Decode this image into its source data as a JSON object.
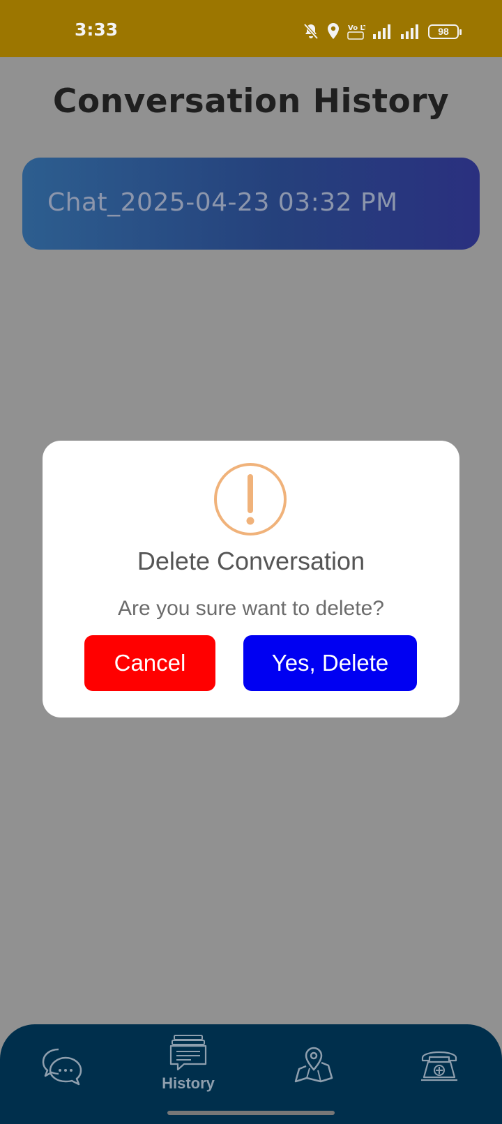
{
  "status_bar": {
    "time": "3:33",
    "battery": "98",
    "network": "Vo LTE",
    "icons": [
      "bell-off-icon",
      "location-icon",
      "volte-icon",
      "signal-icon",
      "signal-icon",
      "battery-icon"
    ]
  },
  "page": {
    "title": "Conversation History"
  },
  "conversations": [
    {
      "label": "Chat_2025-04-23 03:32 PM"
    }
  ],
  "dialog": {
    "icon": "warning-icon",
    "title": "Delete Conversation",
    "message": "Are you sure want to delete?",
    "cancel_label": "Cancel",
    "confirm_label": "Yes, Delete"
  },
  "bottom_nav": {
    "items": [
      {
        "name": "chat",
        "icon": "chat-bubbles-icon",
        "label": ""
      },
      {
        "name": "history",
        "icon": "history-stack-icon",
        "label": "History",
        "active": true
      },
      {
        "name": "map",
        "icon": "map-pin-icon",
        "label": ""
      },
      {
        "name": "emergency",
        "icon": "medical-phone-icon",
        "label": ""
      }
    ]
  },
  "colors": {
    "status_bar": "#9c7600",
    "overlay_bg": "#919191",
    "cancel": "#ff0000",
    "confirm": "#0000f2",
    "nav_bg": "#002f4c",
    "warning": "#f0b27a"
  }
}
